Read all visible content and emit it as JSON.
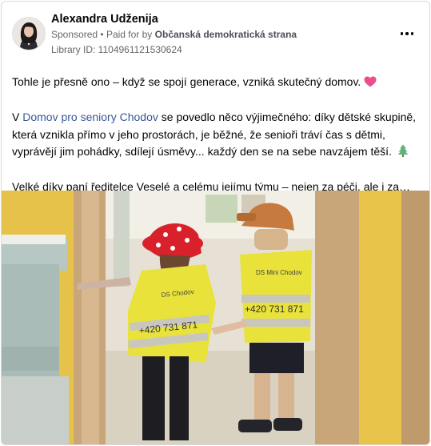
{
  "post": {
    "author": "Alexandra Udženija",
    "sponsored_label": "Sponsored",
    "paid_for_prefix": "Paid for by",
    "payer": "Občanská demokratická strana",
    "library_id": "Library ID: 1104961121530624",
    "paragraph1": "Tohle je přesně ono – když se spojí generace, vzniká skutečný domov.",
    "paragraph1_emoji": "💗",
    "paragraph2_before": "V ",
    "paragraph2_link": "Domov pro seniory Chodov",
    "paragraph2_after": " se povedlo něco výjimečného: díky dětské skupině, která vznikla přímo v jeho prostorách, je běžné, že senioři tráví čas s dětmi, vyprávějí jim pohádky, sdílejí úsměvy... každý den se na sebe navzájem těší.",
    "paragraph2_emoji": "🌲",
    "paragraph3": "Velké díky paní ředitelce Veselé a celému jejímu týmu – nejen za péči, ale i za…",
    "vest_text_left": "+420 731 871",
    "vest_text_right": "+420 731 871",
    "vest_label_left": "DS Chodov",
    "vest_label_right": "DS Mini Chodov"
  },
  "icons": {
    "more": "more-options-icon",
    "heart": "pink-heart-icon",
    "tree": "tree-icon"
  },
  "colors": {
    "link": "#385898",
    "vest": "#e8e23a",
    "wall": "#e9c64a"
  }
}
